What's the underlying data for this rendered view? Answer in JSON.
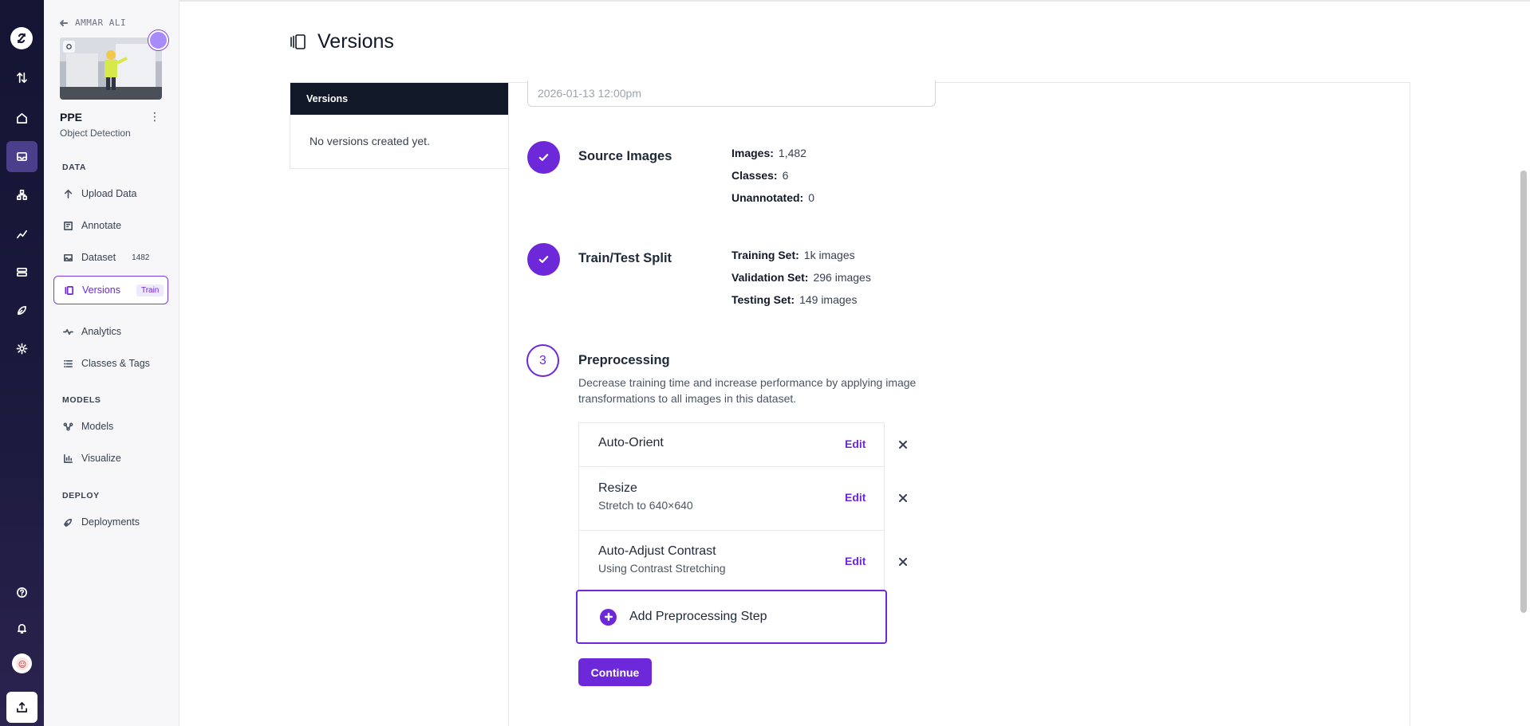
{
  "workspace": {
    "back_label": "AMMAR ALI"
  },
  "project": {
    "name": "PPE",
    "type": "Object Detection"
  },
  "sidebar": {
    "sections": [
      {
        "label": "DATA"
      },
      {
        "label": "MODELS"
      },
      {
        "label": "DEPLOY"
      }
    ],
    "items": [
      {
        "label": "Upload Data",
        "icon": "upload-icon"
      },
      {
        "label": "Annotate",
        "icon": "annotate-icon"
      },
      {
        "label": "Dataset",
        "icon": "image-icon",
        "badge": "1482"
      },
      {
        "label": "Versions",
        "icon": "versions-icon",
        "badge": "Train",
        "active": true
      },
      {
        "label": "Analytics",
        "icon": "heartbeat-icon"
      },
      {
        "label": "Classes & Tags",
        "icon": "list-icon"
      },
      {
        "label": "Models",
        "icon": "graph-icon"
      },
      {
        "label": "Visualize",
        "icon": "chart-icon"
      },
      {
        "label": "Deployments",
        "icon": "rocket-icon"
      }
    ]
  },
  "page": {
    "title": "Versions"
  },
  "versions_panel": {
    "header": "Versions",
    "empty_text": "No versions created yet."
  },
  "date_field": {
    "value": "2026-01-13 12:00pm"
  },
  "steps": {
    "source": {
      "title": "Source Images",
      "rows": [
        {
          "key": "Images:",
          "value": "1,482"
        },
        {
          "key": "Classes:",
          "value": "6"
        },
        {
          "key": "Unannotated:",
          "value": "0"
        }
      ]
    },
    "split": {
      "title": "Train/Test Split",
      "rows": [
        {
          "key": "Training Set:",
          "value": "1k images"
        },
        {
          "key": "Validation Set:",
          "value": "296 images"
        },
        {
          "key": "Testing Set:",
          "value": "149 images"
        }
      ]
    },
    "preprocessing": {
      "number": "3",
      "title": "Preprocessing",
      "description": "Decrease training time and increase performance by applying image transformations to all images in this dataset.",
      "items": [
        {
          "name": "Auto-Orient",
          "sub": "",
          "edit": "Edit"
        },
        {
          "name": "Resize",
          "sub": "Stretch to 640×640",
          "edit": "Edit"
        },
        {
          "name": "Auto-Adjust Contrast",
          "sub": "Using Contrast Stretching",
          "edit": "Edit"
        }
      ],
      "add_label": "Add Preprocessing Step",
      "continue_label": "Continue"
    }
  },
  "colors": {
    "accent": "#6d28d9",
    "rail": "#1a1838",
    "header_dark": "#111827"
  }
}
